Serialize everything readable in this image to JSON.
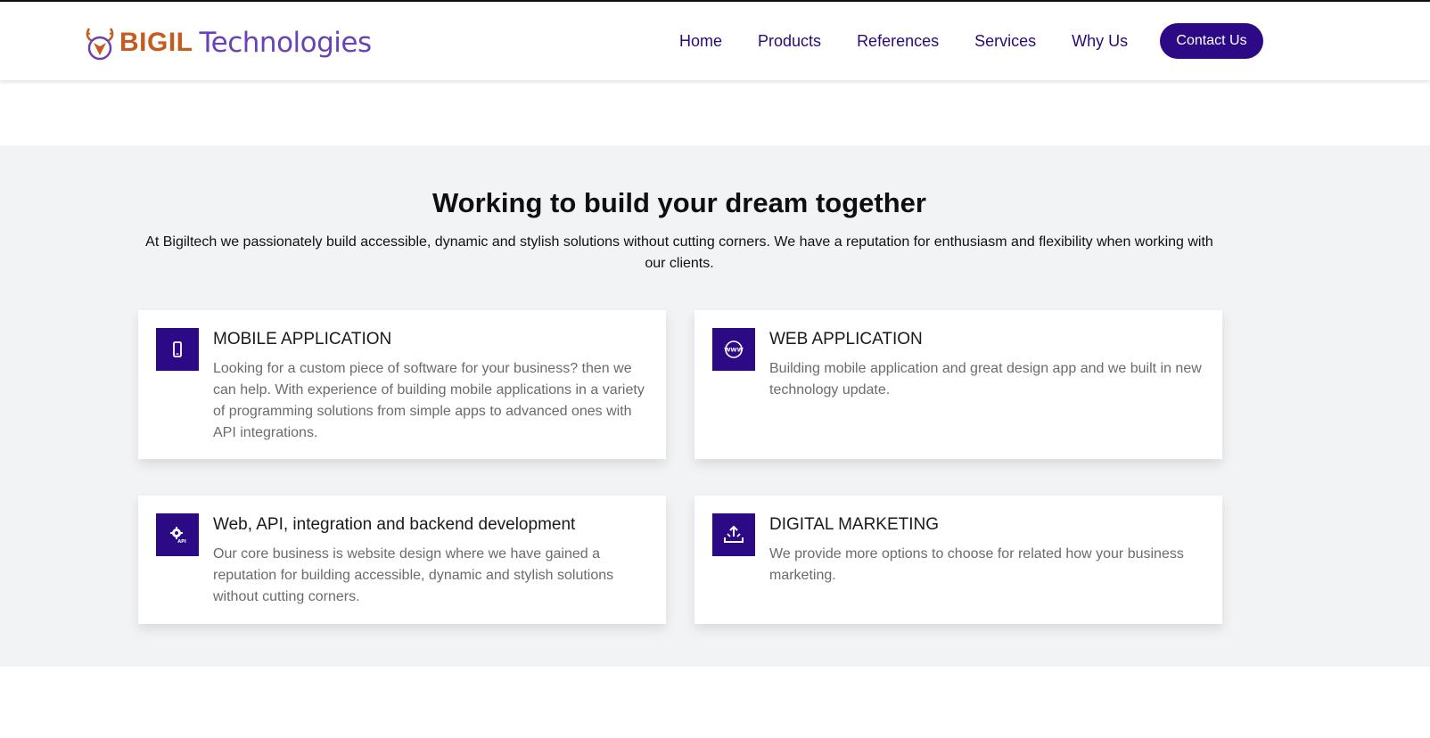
{
  "header": {
    "logo": {
      "brand": "BIGIL",
      "suffix": "Technologies",
      "icon": "deer-icon"
    },
    "nav": [
      {
        "label": "Home"
      },
      {
        "label": "Products"
      },
      {
        "label": "References"
      },
      {
        "label": "Services"
      },
      {
        "label": "Why Us"
      }
    ],
    "contact_label": "Contact Us"
  },
  "section": {
    "title": "Working to build your dream together",
    "subtitle": "At Bigiltech we passionately build accessible, dynamic and stylish solutions without cutting corners. We have a reputation for enthusiasm and flexibility when working with our clients.",
    "cards": [
      {
        "icon": "mobile-phone-icon",
        "title": "MOBILE APPLICATION",
        "text": "Looking for a custom piece of software for your business? then we can help. With experience of building mobile applications in a variety of programming solutions from simple apps to advanced ones with API integrations."
      },
      {
        "icon": "www-globe-icon",
        "title": "WEB APPLICATION",
        "text": "Building mobile application and great design app and we built in new technology update."
      },
      {
        "icon": "api-gear-icon",
        "title": "Web, API, integration and backend development",
        "text": "Our core business is website design where we have gained a reputation for building accessible, dynamic and stylish solutions without cutting corners.",
        "icon_text": "API"
      },
      {
        "icon": "share-upload-icon",
        "title": "DIGITAL MARKETING",
        "text": "We provide more options to choose for related how your business marketing."
      }
    ]
  },
  "colors": {
    "primary": "#2d0a85",
    "brand_orange": "#c45c1f",
    "brand_purple": "#6a42b8",
    "section_bg": "#f2f3f5"
  }
}
